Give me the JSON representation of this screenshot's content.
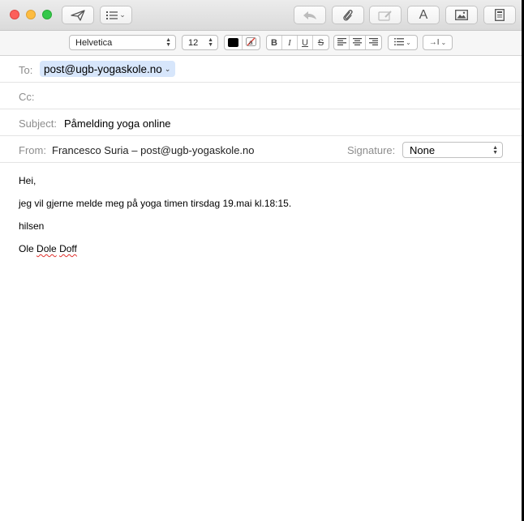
{
  "toolbar": {
    "buttons": [
      {
        "name": "send",
        "icon": "paper-plane-icon"
      },
      {
        "name": "header-fields",
        "icon": "list-icon"
      },
      {
        "name": "reply",
        "icon": "reply-arrow-icon"
      },
      {
        "name": "attach",
        "icon": "paperclip-icon"
      },
      {
        "name": "markup",
        "icon": "markup-icon"
      },
      {
        "name": "format",
        "icon": "format-text-icon",
        "label": "A"
      },
      {
        "name": "photo",
        "icon": "photo-browser-icon"
      },
      {
        "name": "stationery",
        "icon": "stationery-icon"
      }
    ]
  },
  "formatbar": {
    "font": "Helvetica",
    "size": "12",
    "bold": "B",
    "italic": "I",
    "underline": "U",
    "strikethrough": "S",
    "text_color": "#000000",
    "indent_symbol": "→I"
  },
  "header": {
    "to_label": "To:",
    "to_value": "post@ugb-yogaskole.no",
    "cc_label": "Cc:",
    "subject_label": "Subject:",
    "subject_value": "Påmelding yoga online",
    "from_label": "From:",
    "from_value": "Francesco Suria – post@ugb-yogaskole.no",
    "signature_label": "Signature:",
    "signature_value": "None"
  },
  "body": {
    "greeting": "Hei,",
    "line1": "jeg vil gjerne melde meg på yoga timen tirsdag 19.mai kl.18:15.",
    "closing": "hilsen",
    "sig_first": "Ole",
    "sig_middle": "Dole",
    "sig_last": "Doff"
  },
  "colors": {
    "token_bg": "#d7e6fb",
    "close": "#fc605b",
    "minimize": "#fdbc40",
    "zoom": "#34c84a",
    "spellcheck": "#e0302c"
  }
}
